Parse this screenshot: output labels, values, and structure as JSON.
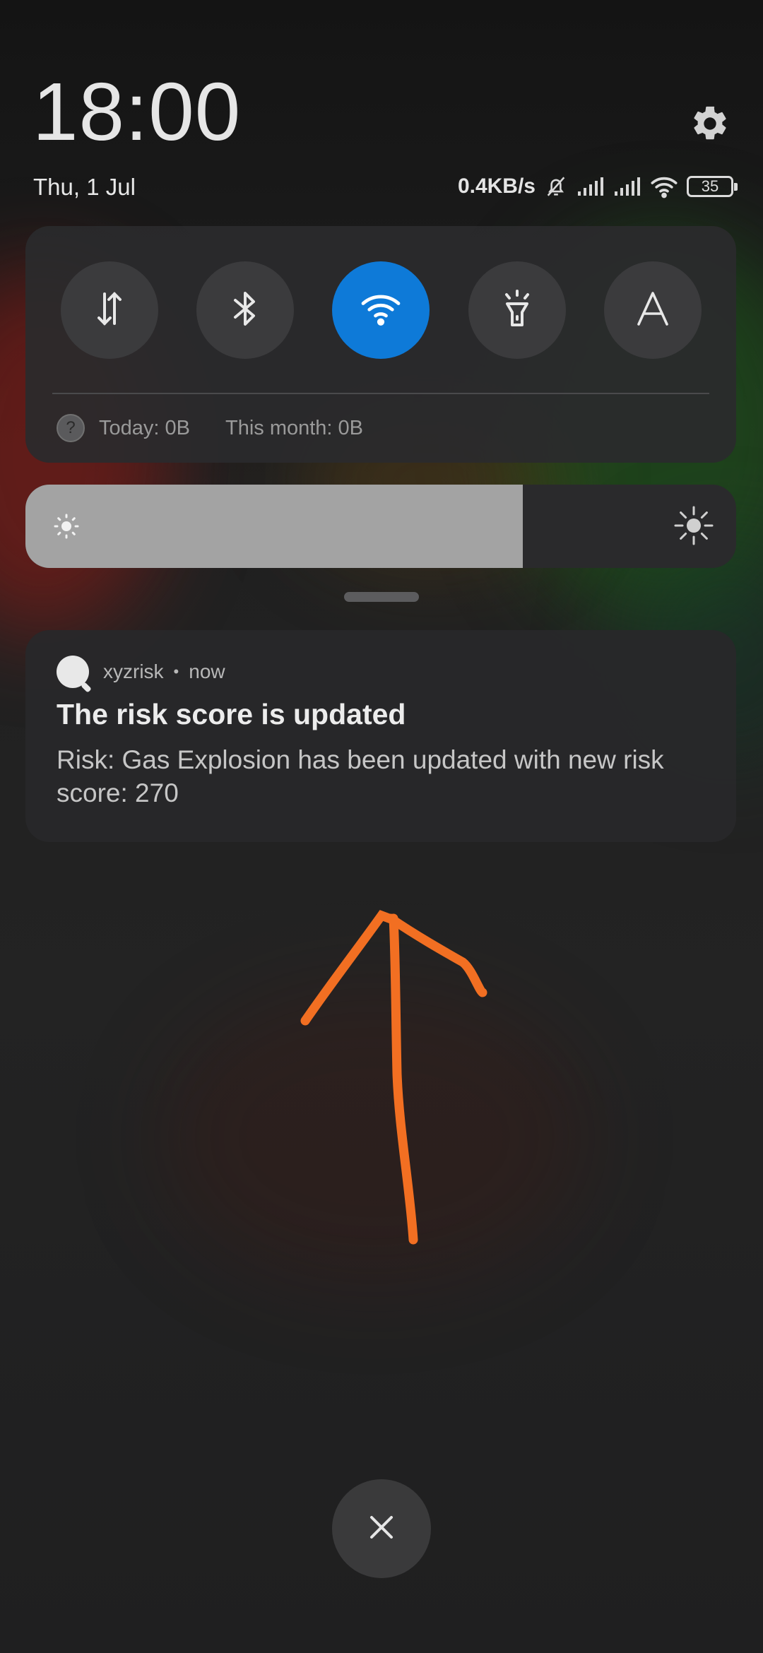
{
  "header": {
    "time": "18:00",
    "date": "Thu, 1 Jul"
  },
  "status_bar": {
    "network_speed": "0.4KB/s",
    "battery_level": "35",
    "icons": [
      "bell-muted-icon",
      "signal-icon",
      "signal-icon",
      "wifi-icon",
      "battery-icon"
    ]
  },
  "quick_settings": {
    "tiles": [
      {
        "name": "mobile-data",
        "icon": "data-arrows-icon",
        "active": false
      },
      {
        "name": "bluetooth",
        "icon": "bluetooth-icon",
        "active": false
      },
      {
        "name": "wifi",
        "icon": "wifi-icon",
        "active": true
      },
      {
        "name": "flashlight",
        "icon": "flashlight-icon",
        "active": false
      },
      {
        "name": "auto-brightness",
        "icon": "auto-brightness-icon",
        "active": false,
        "label": "A"
      }
    ],
    "usage_today": "Today: 0B",
    "usage_month": "This month: 0B",
    "accent_color": "#0e7ad8"
  },
  "brightness": {
    "level_fraction": 0.7
  },
  "notification": {
    "app_name": "xyzrisk",
    "separator": "•",
    "time": "now",
    "title": "The risk score is updated",
    "body": "Risk: Gas Explosion has been updated with new risk score: 270"
  },
  "annotation": {
    "color": "#f26f22",
    "shape": "hand-drawn-arrow-up"
  },
  "close_button": {
    "icon": "close-icon",
    "label": "×"
  }
}
